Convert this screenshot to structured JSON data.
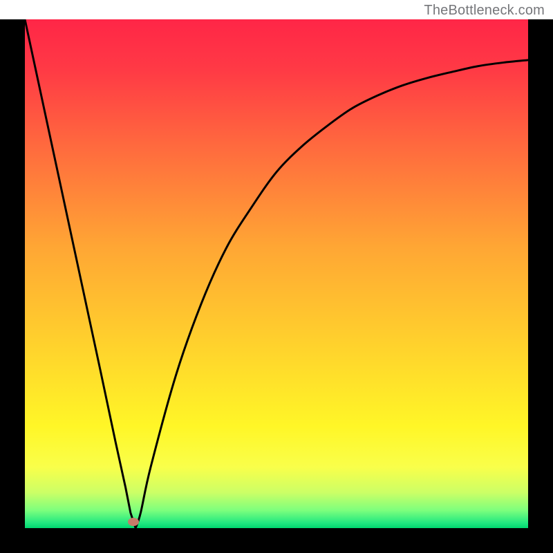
{
  "watermark": "TheBottleneck.com",
  "chart_data": {
    "type": "line",
    "title": "",
    "xlabel": "",
    "ylabel": "",
    "xlim": [
      0,
      100
    ],
    "ylim": [
      0,
      100
    ],
    "x": [
      0,
      5,
      10,
      15,
      18,
      20,
      21,
      22,
      23,
      25,
      30,
      35,
      40,
      45,
      50,
      55,
      60,
      65,
      70,
      75,
      80,
      85,
      90,
      95,
      100
    ],
    "y": [
      100,
      77,
      54,
      31,
      17,
      8,
      3,
      0,
      3,
      12,
      30,
      44,
      55,
      63,
      70,
      75,
      79,
      82.5,
      85,
      87,
      88.5,
      89.7,
      90.8,
      91.5,
      92
    ],
    "minimum_x": 22,
    "minimum_y": 0,
    "marker": {
      "x": 21.5,
      "y": 1.2,
      "color": "#c77b69"
    },
    "gradient_stops": [
      {
        "pos": 0.0,
        "color": "#ff2647"
      },
      {
        "pos": 0.1,
        "color": "#ff3a45"
      },
      {
        "pos": 0.25,
        "color": "#ff6a3e"
      },
      {
        "pos": 0.45,
        "color": "#ffa734"
      },
      {
        "pos": 0.65,
        "color": "#ffd42c"
      },
      {
        "pos": 0.8,
        "color": "#fff627"
      },
      {
        "pos": 0.88,
        "color": "#f9ff4a"
      },
      {
        "pos": 0.93,
        "color": "#ccff66"
      },
      {
        "pos": 0.965,
        "color": "#7dff7d"
      },
      {
        "pos": 0.99,
        "color": "#20e880"
      },
      {
        "pos": 1.0,
        "color": "#00d66f"
      }
    ],
    "curve_color": "#000000",
    "curve_width": 3
  }
}
